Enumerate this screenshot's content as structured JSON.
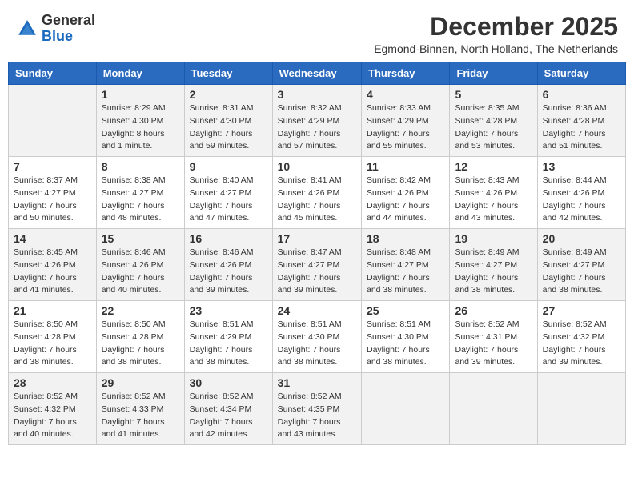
{
  "logo": {
    "general": "General",
    "blue": "Blue"
  },
  "header": {
    "title": "December 2025",
    "subtitle": "Egmond-Binnen, North Holland, The Netherlands"
  },
  "weekdays": [
    "Sunday",
    "Monday",
    "Tuesday",
    "Wednesday",
    "Thursday",
    "Friday",
    "Saturday"
  ],
  "weeks": [
    [
      {
        "day": "",
        "info": ""
      },
      {
        "day": "1",
        "info": "Sunrise: 8:29 AM\nSunset: 4:30 PM\nDaylight: 8 hours\nand 1 minute."
      },
      {
        "day": "2",
        "info": "Sunrise: 8:31 AM\nSunset: 4:30 PM\nDaylight: 7 hours\nand 59 minutes."
      },
      {
        "day": "3",
        "info": "Sunrise: 8:32 AM\nSunset: 4:29 PM\nDaylight: 7 hours\nand 57 minutes."
      },
      {
        "day": "4",
        "info": "Sunrise: 8:33 AM\nSunset: 4:29 PM\nDaylight: 7 hours\nand 55 minutes."
      },
      {
        "day": "5",
        "info": "Sunrise: 8:35 AM\nSunset: 4:28 PM\nDaylight: 7 hours\nand 53 minutes."
      },
      {
        "day": "6",
        "info": "Sunrise: 8:36 AM\nSunset: 4:28 PM\nDaylight: 7 hours\nand 51 minutes."
      }
    ],
    [
      {
        "day": "7",
        "info": "Sunrise: 8:37 AM\nSunset: 4:27 PM\nDaylight: 7 hours\nand 50 minutes."
      },
      {
        "day": "8",
        "info": "Sunrise: 8:38 AM\nSunset: 4:27 PM\nDaylight: 7 hours\nand 48 minutes."
      },
      {
        "day": "9",
        "info": "Sunrise: 8:40 AM\nSunset: 4:27 PM\nDaylight: 7 hours\nand 47 minutes."
      },
      {
        "day": "10",
        "info": "Sunrise: 8:41 AM\nSunset: 4:26 PM\nDaylight: 7 hours\nand 45 minutes."
      },
      {
        "day": "11",
        "info": "Sunrise: 8:42 AM\nSunset: 4:26 PM\nDaylight: 7 hours\nand 44 minutes."
      },
      {
        "day": "12",
        "info": "Sunrise: 8:43 AM\nSunset: 4:26 PM\nDaylight: 7 hours\nand 43 minutes."
      },
      {
        "day": "13",
        "info": "Sunrise: 8:44 AM\nSunset: 4:26 PM\nDaylight: 7 hours\nand 42 minutes."
      }
    ],
    [
      {
        "day": "14",
        "info": "Sunrise: 8:45 AM\nSunset: 4:26 PM\nDaylight: 7 hours\nand 41 minutes."
      },
      {
        "day": "15",
        "info": "Sunrise: 8:46 AM\nSunset: 4:26 PM\nDaylight: 7 hours\nand 40 minutes."
      },
      {
        "day": "16",
        "info": "Sunrise: 8:46 AM\nSunset: 4:26 PM\nDaylight: 7 hours\nand 39 minutes."
      },
      {
        "day": "17",
        "info": "Sunrise: 8:47 AM\nSunset: 4:27 PM\nDaylight: 7 hours\nand 39 minutes."
      },
      {
        "day": "18",
        "info": "Sunrise: 8:48 AM\nSunset: 4:27 PM\nDaylight: 7 hours\nand 38 minutes."
      },
      {
        "day": "19",
        "info": "Sunrise: 8:49 AM\nSunset: 4:27 PM\nDaylight: 7 hours\nand 38 minutes."
      },
      {
        "day": "20",
        "info": "Sunrise: 8:49 AM\nSunset: 4:27 PM\nDaylight: 7 hours\nand 38 minutes."
      }
    ],
    [
      {
        "day": "21",
        "info": "Sunrise: 8:50 AM\nSunset: 4:28 PM\nDaylight: 7 hours\nand 38 minutes."
      },
      {
        "day": "22",
        "info": "Sunrise: 8:50 AM\nSunset: 4:28 PM\nDaylight: 7 hours\nand 38 minutes."
      },
      {
        "day": "23",
        "info": "Sunrise: 8:51 AM\nSunset: 4:29 PM\nDaylight: 7 hours\nand 38 minutes."
      },
      {
        "day": "24",
        "info": "Sunrise: 8:51 AM\nSunset: 4:30 PM\nDaylight: 7 hours\nand 38 minutes."
      },
      {
        "day": "25",
        "info": "Sunrise: 8:51 AM\nSunset: 4:30 PM\nDaylight: 7 hours\nand 38 minutes."
      },
      {
        "day": "26",
        "info": "Sunrise: 8:52 AM\nSunset: 4:31 PM\nDaylight: 7 hours\nand 39 minutes."
      },
      {
        "day": "27",
        "info": "Sunrise: 8:52 AM\nSunset: 4:32 PM\nDaylight: 7 hours\nand 39 minutes."
      }
    ],
    [
      {
        "day": "28",
        "info": "Sunrise: 8:52 AM\nSunset: 4:32 PM\nDaylight: 7 hours\nand 40 minutes."
      },
      {
        "day": "29",
        "info": "Sunrise: 8:52 AM\nSunset: 4:33 PM\nDaylight: 7 hours\nand 41 minutes."
      },
      {
        "day": "30",
        "info": "Sunrise: 8:52 AM\nSunset: 4:34 PM\nDaylight: 7 hours\nand 42 minutes."
      },
      {
        "day": "31",
        "info": "Sunrise: 8:52 AM\nSunset: 4:35 PM\nDaylight: 7 hours\nand 43 minutes."
      },
      {
        "day": "",
        "info": ""
      },
      {
        "day": "",
        "info": ""
      },
      {
        "day": "",
        "info": ""
      }
    ]
  ]
}
